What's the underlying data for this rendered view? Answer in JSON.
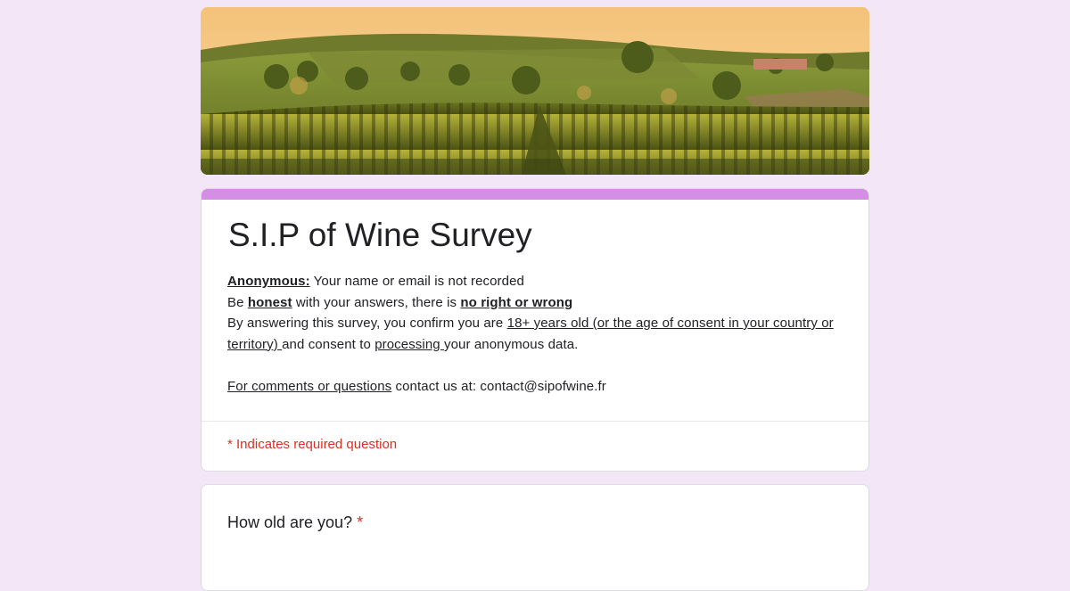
{
  "form": {
    "title": "S.I.P of Wine Survey",
    "accent_color": "#d48fe4",
    "background_color": "#f2e6f7",
    "banner_image": "vineyard-landscape",
    "description": {
      "line1": {
        "label": "Anonymous:",
        "text": " Your name or email is not recorded"
      },
      "line2": {
        "pre": "Be ",
        "honest": "honest",
        "mid": " with your answers, there is ",
        "no_right": "no right or wrong"
      },
      "line3": {
        "pre": "By answering this survey, you confirm you are ",
        "age": "18+ years old (or the age of consent in your country or territory) ",
        "mid": "and consent to ",
        "processing": "processing ",
        "post": "your anonymous data."
      },
      "line4": {
        "link": "For comments or questions",
        "text": " contact us at: contact@sipofwine.fr"
      }
    },
    "required_note": "* Indicates required question"
  },
  "questions": [
    {
      "label": "How old are you?",
      "required_mark": "*"
    }
  ]
}
